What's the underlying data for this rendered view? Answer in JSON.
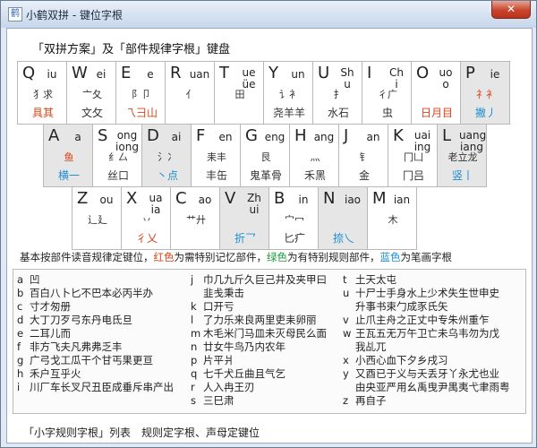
{
  "window": {
    "title": "小鹤双拼 - 键位字根",
    "close": "✕",
    "app_icon": "鹤"
  },
  "heading": "「双拼方案」及「部件规律字根」键盘",
  "keyboard": {
    "row1": [
      {
        "letter": "Q",
        "yun": "iu",
        "comp1": "犭求",
        "comp2": "具其",
        "comp2_color": "red"
      },
      {
        "letter": "W",
        "yun": "ei",
        "comp1": "亠夂",
        "comp2": "文攵",
        "comp2_color": ""
      },
      {
        "letter": "E",
        "yun": "e",
        "comp1": "阝卩",
        "comp2": "乁彐山",
        "comp2_color": "red"
      },
      {
        "letter": "R",
        "yun": "uan",
        "comp1": "亻",
        "comp2": "",
        "comp2_color": ""
      },
      {
        "letter": "T",
        "yun": "ue\nüe",
        "comp1": "田",
        "comp2": "",
        "comp2_color": ""
      },
      {
        "letter": "Y",
        "yun": "un",
        "comp1": "讠衤",
        "comp2": "尧羊羊",
        "comp2_color": ""
      },
      {
        "letter": "U",
        "yun": "Sh\nu",
        "comp1": "扌",
        "comp2": "水石",
        "comp2_color": ""
      },
      {
        "letter": "I",
        "yun": "Ch\ni",
        "comp1": "彳广",
        "comp2": "虫",
        "comp2_color": ""
      },
      {
        "letter": "O",
        "yun": "uo\no",
        "comp1": "",
        "comp2": "日月目",
        "comp2_color": "red"
      },
      {
        "letter": "P",
        "yun": "ie",
        "comp1": "礻衤",
        "comp2": "撇丿",
        "comp2_color": "blue",
        "gray": true,
        "comp1_color": "red"
      }
    ],
    "row2": [
      {
        "letter": "A",
        "yun": "a",
        "comp1": "鱼",
        "comp2": "横一",
        "comp2_color": "blue",
        "gray": true,
        "comp1_color": "red"
      },
      {
        "letter": "S",
        "yun": "ong\niong",
        "comp1": "纟厶",
        "comp2": "丝口",
        "comp2_color": ""
      },
      {
        "letter": "D",
        "yun": "ai",
        "comp1": "氵冫",
        "comp2": "丶点",
        "comp2_color": "blue",
        "gray": true
      },
      {
        "letter": "F",
        "yun": "en",
        "comp1": "耒丰",
        "comp2": "丰缶",
        "comp2_color": ""
      },
      {
        "letter": "G",
        "yun": "eng",
        "comp1": "艮",
        "comp2": "鬼革骨",
        "comp2_color": ""
      },
      {
        "letter": "H",
        "yun": "ang",
        "comp1": "灬",
        "comp2": "禾黑",
        "comp2_color": ""
      },
      {
        "letter": "J",
        "yun": "an",
        "comp1": "钅",
        "comp2": "金",
        "comp2_color": ""
      },
      {
        "letter": "K",
        "yun": "uai\ning",
        "comp1": "冂凵",
        "comp2": "冂吕",
        "comp2_color": ""
      },
      {
        "letter": "L",
        "yun": "uang\niang",
        "comp1": "老立龙",
        "comp2": "竖丨",
        "comp2_color": "blue",
        "gray": true
      }
    ],
    "row3": [
      {
        "letter": "Z",
        "yun": "ou",
        "comp1": "辶廴",
        "comp2": "",
        "comp2_color": ""
      },
      {
        "letter": "X",
        "yun": "ua\nia",
        "comp1": "丷",
        "comp2": "彳乂",
        "comp2_color": "red"
      },
      {
        "letter": "C",
        "yun": "ao",
        "comp1": "艹廾",
        "comp2": "",
        "comp2_color": ""
      },
      {
        "letter": "V",
        "yun": "Zh\nui",
        "comp1": "",
        "comp2": "折乛",
        "comp2_color": "blue",
        "gray": true
      },
      {
        "letter": "B",
        "yun": "in",
        "comp1": "宀冖",
        "comp2": "匕疒",
        "comp2_color": ""
      },
      {
        "letter": "N",
        "yun": "iao",
        "comp1": "",
        "comp2": "捺乀",
        "comp2_color": "blue",
        "gray": true
      },
      {
        "letter": "M",
        "yun": "ian",
        "comp1": "木",
        "comp2": "",
        "comp2_color": ""
      }
    ]
  },
  "note": {
    "part1": "基本按部件读音规律定键位，",
    "red_word": "红色",
    "part2": "为需特别记忆部件，",
    "green_word": "绿色",
    "part3": "为有特别规则部件，",
    "blue_word": "蓝色",
    "part4": "为笔画字根"
  },
  "table": {
    "col1": [
      {
        "l": "a",
        "t": "凹"
      },
      {
        "l": "b",
        "t": "百白八卜匕不巴本必丙半办"
      },
      {
        "l": "c",
        "t": "寸才匆册"
      },
      {
        "l": "d",
        "t": "大丁刀歹弓东丹电氐旦"
      },
      {
        "l": "e",
        "t": "二耳儿而"
      },
      {
        "l": "f",
        "t": "非方飞夫凡弗弗乏丰"
      },
      {
        "l": "g",
        "t": "广弓戈工瓜干个甘丐果更亘"
      },
      {
        "l": "h",
        "t": "禾户互乎火"
      },
      {
        "l": "i",
        "t": "川厂车长叉尺丑臣成垂斥串产出"
      }
    ],
    "col2": [
      {
        "l": "j",
        "t": "巾几九斤久巨己井及夹甲曰"
      },
      {
        "l": "",
        "t": "韭戋秉击"
      },
      {
        "l": "k",
        "t": "口开亏"
      },
      {
        "l": "l",
        "t": "了力乐来良两里吏耒卵丽"
      },
      {
        "l": "m",
        "t": "木毛米门马皿未灭母民么面"
      },
      {
        "l": "n",
        "t": "廿女牛鸟乃内农年"
      },
      {
        "l": "p",
        "t": "片平爿"
      },
      {
        "l": "q",
        "t": "七千犬丘曲且气乞"
      },
      {
        "l": "r",
        "t": "人入冉王刃"
      },
      {
        "l": "s",
        "t": "三巳肃"
      }
    ],
    "col3": [
      {
        "l": "t",
        "t": "土天太屯"
      },
      {
        "l": "u",
        "t": "十尸士手身水上少术失生世申史"
      },
      {
        "l": "",
        "t": "升事书束勹成豕氏矢"
      },
      {
        "l": "v",
        "t": "止爪主舟之正丈中专朱州重乍"
      },
      {
        "l": "w",
        "t": "王瓦五无万午卫亡未乌韦勿为戊"
      },
      {
        "l": "",
        "t": "我乩兀"
      },
      {
        "l": "x",
        "t": "小西心血下夕乡戌习"
      },
      {
        "l": "y",
        "t": "又酉已于义与夭丢牙丫永尤也业"
      },
      {
        "l": "",
        "t": "由央亚严用幺禹曳尹禺夷弋聿雨粤"
      },
      {
        "l": "z",
        "t": "再自子"
      }
    ]
  },
  "footer": "「小字规则字根」列表　规则定字根、声母定键位"
}
